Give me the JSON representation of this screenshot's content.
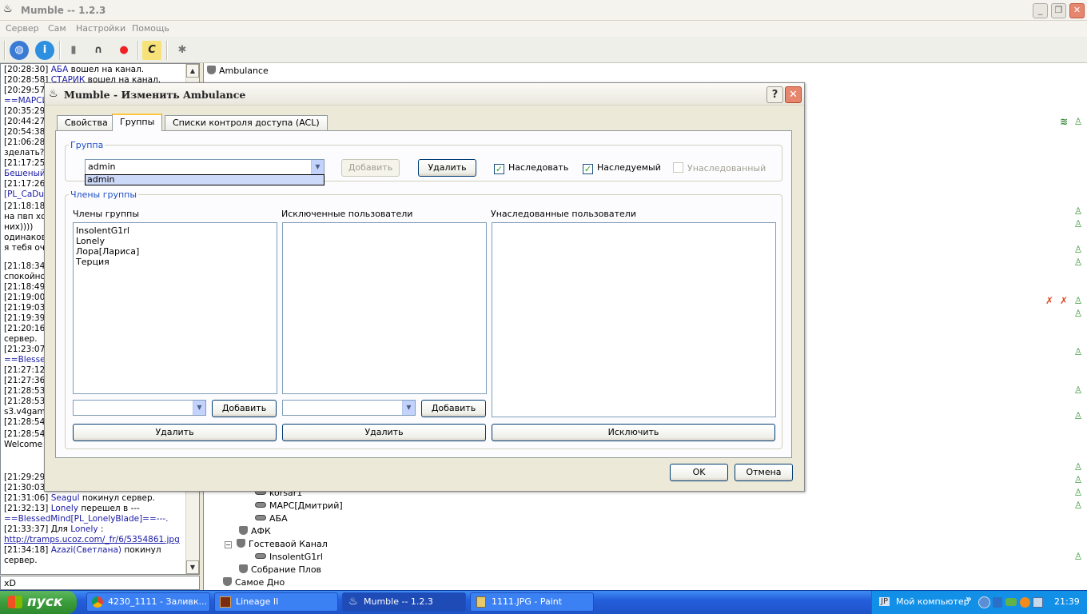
{
  "app": {
    "title": "Mumble -- 1.2.3"
  },
  "menu": [
    "Сервер",
    "Сам",
    "Настройки",
    "Помощь"
  ],
  "log": [
    {
      "t": "[20:28:30]",
      "who": "АБА",
      "msg": "вошел на канал."
    },
    {
      "t": "[20:28:58]",
      "who": "СТАРИК",
      "msg": "вошел на канал."
    },
    {
      "t": "[20:29:57]",
      "who": "",
      "msg": ""
    },
    {
      "t": "==МАРСИ",
      "who": "",
      "msg": ""
    },
    {
      "t": "[20:35:29]",
      "who": "",
      "msg": ""
    },
    {
      "t": "[20:44:27]",
      "who": "",
      "msg": ""
    },
    {
      "t": "[20:54:38]",
      "who": "",
      "msg": ""
    },
    {
      "t": "[21:06:28]",
      "who": "",
      "msg": ""
    },
    {
      "t": "зделать?",
      "who": "",
      "msg": ""
    },
    {
      "t": "[21:17:25]",
      "who": "",
      "msg": ""
    },
    {
      "t": "Бешеный",
      "who": "",
      "msg": ""
    },
    {
      "t": "[21:17:26]",
      "who": "",
      "msg": ""
    },
    {
      "t": "[PL_CaDu",
      "who": "",
      "msg": ""
    },
    {
      "t": "[21:18:18",
      "who": "",
      "msg": ""
    },
    {
      "t": "на пвп хо",
      "who": "",
      "msg": ""
    },
    {
      "t": "них))))",
      "who": "",
      "msg": ""
    },
    {
      "t": "одинаков",
      "who": "",
      "msg": ""
    },
    {
      "t": "я тебя оч",
      "who": "",
      "msg": ""
    },
    {
      "t": "[21:18:34]",
      "who": "",
      "msg": ""
    },
    {
      "t": "спокойно",
      "who": "",
      "msg": ""
    },
    {
      "t": "[21:18:49]",
      "who": "",
      "msg": ""
    },
    {
      "t": "[21:19:00]",
      "who": "",
      "msg": ""
    },
    {
      "t": "[21:19:03]",
      "who": "",
      "msg": ""
    },
    {
      "t": "[21:19:39]",
      "who": "",
      "msg": ""
    },
    {
      "t": "[21:20:16]",
      "who": "",
      "msg": ""
    },
    {
      "t": "сервер.",
      "who": "",
      "msg": ""
    },
    {
      "t": "[21:23:07]",
      "who": "",
      "msg": ""
    },
    {
      "t": "==Blessed",
      "who": "",
      "msg": ""
    },
    {
      "t": "[21:27:12]",
      "who": "",
      "msg": ""
    },
    {
      "t": "[21:27:36]",
      "who": "",
      "msg": ""
    },
    {
      "t": "[21:28:53]",
      "who": "",
      "msg": ""
    },
    {
      "t": "[21:28:53]",
      "who": "",
      "msg": ""
    },
    {
      "t": "s3.v4game",
      "who": "",
      "msg": ""
    },
    {
      "t": "[21:28:54]",
      "who": "",
      "msg": ""
    },
    {
      "t": "[21:28:54",
      "who": "",
      "msg": ""
    },
    {
      "t": "Welcome",
      "who": "",
      "msg": ""
    },
    {
      "t": "[21:29:29]",
      "who": "",
      "msg": ""
    },
    {
      "t": "[21:30:03]",
      "who": "",
      "msg": ""
    },
    {
      "t": "[21:31:06]",
      "who": "Seagul",
      "msg": "покинул сервер."
    },
    {
      "t": "[21:32:13]",
      "who": "Lonely",
      "msg": "перешел в ---"
    },
    {
      "t": "==BlessedMind[PL_LonelyBlade]==---.",
      "who": "",
      "msg": ""
    },
    {
      "t": "[21:33:37] Для",
      "who": "Lonely",
      "msg": ":"
    },
    {
      "t": "http://tramps.ucoz.com/_fr/6/5354861.jpg",
      "who": "",
      "msg": ""
    },
    {
      "t": "[21:34:18]",
      "who": "Azazi(Светлана)",
      "msg": "покинул"
    },
    {
      "t": "сервер.",
      "who": "",
      "msg": ""
    }
  ],
  "chat_input": "xD",
  "tree": {
    "root": "Ambulance",
    "items": [
      "korsar1",
      "МАРС[Дмитрий]",
      "АБА",
      "АФК",
      "Гостеваой Канал",
      "InsolentG1rl",
      "Собрание Плов",
      "Самое Дно"
    ]
  },
  "dialog": {
    "title": "Mumble - Изменить Ambulance",
    "tabs": [
      "Свойства",
      "Группы",
      "Списки контроля доступа (ACL)"
    ],
    "group_label": "Группа",
    "group_value": "admin",
    "dropdown_item": "admin",
    "add_label": "Добавить",
    "remove_label": "Удалить",
    "inherit_label": "Наследовать",
    "inheritable_label": "Наследуемый",
    "inherited_label": "Унаследованный",
    "members_group_label": "Члены группы",
    "members_caption": "Члены группы",
    "excluded_caption": "Исключенные пользователи",
    "inherited_caption": "Унаследованные пользователи",
    "members": [
      "InsolentG1rl",
      "Lonely",
      "Лора[Лариса]",
      "Терция"
    ],
    "exclude_label": "Исключить",
    "ok_label": "OK",
    "cancel_label": "Отмена"
  },
  "taskbar": {
    "start": "пуск",
    "items": [
      "4230_1111 - Заливк...",
      "Lineage II",
      "Mumble -- 1.2.3",
      "1111.JPG - Paint"
    ],
    "lang": "JP",
    "mycomp": "Мой компьютер",
    "clock": "21:39"
  }
}
